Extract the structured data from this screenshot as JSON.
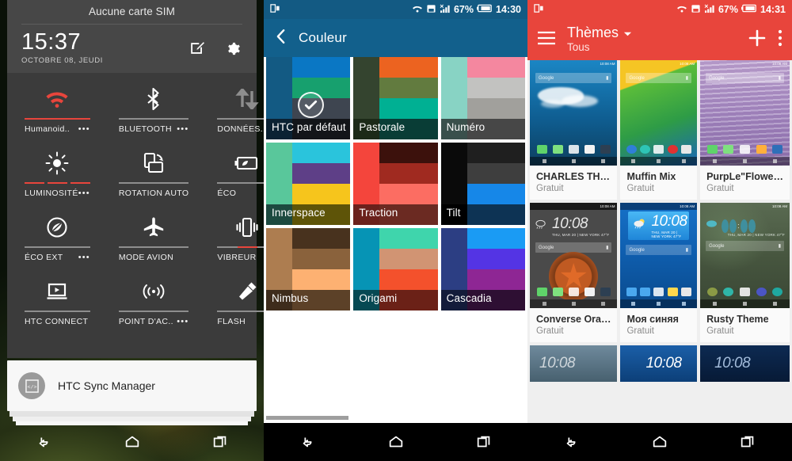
{
  "panel1": {
    "name": "quick-settings-shade",
    "sim_status": "Aucune carte SIM",
    "time": "15:37",
    "date": "OCTOBRE 08, JEUDI",
    "actions": [
      {
        "name": "edit-icon",
        "label": "Modifier"
      },
      {
        "name": "settings-gear-icon",
        "label": "Paramètres"
      }
    ],
    "tiles": [
      {
        "icon": "wifi-icon",
        "label": "Humanoid..",
        "dots": "•••",
        "state": "on",
        "accent": "#e8453c"
      },
      {
        "icon": "bluetooth-icon",
        "label": "BLUETOOTH",
        "dots": "•••",
        "state": "off",
        "accent": "#8e8e8e"
      },
      {
        "icon": "data-sync-icon",
        "label": "DONNÉES..",
        "dots": "•••",
        "state": "off",
        "accent": "#8e8e8e"
      },
      {
        "icon": "brightness-icon",
        "label": "LUMINOSITÉ",
        "dots": "•••",
        "state": "segmented",
        "accent": "#e8453c"
      },
      {
        "icon": "auto-rotate-icon",
        "label": "ROTATION AUTO",
        "dots": "",
        "state": "off",
        "accent": "#8e8e8e"
      },
      {
        "icon": "eco-battery-icon",
        "label": "ÉCO",
        "dots": "•••",
        "state": "off",
        "accent": "#8e8e8e"
      },
      {
        "icon": "eco-extreme-icon",
        "label": "ÉCO EXT",
        "dots": "•••",
        "state": "off",
        "accent": "#8e8e8e"
      },
      {
        "icon": "airplane-icon",
        "label": "MODE AVION",
        "dots": "",
        "state": "off",
        "accent": "#8e8e8e"
      },
      {
        "icon": "vibrate-icon",
        "label": "VIBREUR",
        "dots": "",
        "state": "middle",
        "accent": "#e8453c"
      },
      {
        "icon": "htc-connect-icon",
        "label": "HTC CONNECT",
        "dots": "",
        "state": "off",
        "accent": "#8e8e8e"
      },
      {
        "icon": "hotspot-icon",
        "label": "POINT D'AC..",
        "dots": "•••",
        "state": "off",
        "accent": "#8e8e8e"
      },
      {
        "icon": "flashlight-icon",
        "label": "FLASH",
        "dots": "",
        "state": "off",
        "accent": "#8e8e8e"
      }
    ],
    "notification": {
      "title": "HTC Sync Manager",
      "avatar_icon": "code-brackets-icon"
    },
    "navbar": [
      {
        "name": "back-nav-button",
        "icon": "back-arrow-icon"
      },
      {
        "name": "home-nav-button",
        "icon": "home-icon"
      },
      {
        "name": "recents-nav-button",
        "icon": "recents-icon"
      }
    ]
  },
  "panel2": {
    "name": "color-theme-picker",
    "status_bar": {
      "left_icon": "dual-window-icon",
      "icons": [
        "wifi-icon",
        "sd-card-icon",
        "signal-icon"
      ],
      "battery_percent": "67%",
      "battery_icon": "battery-icon",
      "time": "14:30",
      "bg": "#135a83"
    },
    "app_bar": {
      "back_icon": "back-chevron-icon",
      "title": "Couleur",
      "bg": "#12608c"
    },
    "themes": [
      {
        "name": "HTC par défaut",
        "selected": true,
        "sidebar": [
          "#135a83",
          "#135a83",
          "#135a83",
          "#0b2233"
        ],
        "main": [
          "#0a77c4",
          "#17a06e",
          "#3e4550",
          "#131519"
        ]
      },
      {
        "name": "Pastorale",
        "selected": false,
        "sidebar": [
          "#34442f",
          "#34442f",
          "#34442f",
          "#1c2a18"
        ],
        "main": [
          "#ec6320",
          "#627b3f",
          "#00b093",
          "#093d36"
        ]
      },
      {
        "name": "Numéro",
        "selected": false,
        "sidebar": [
          "#88d3c4",
          "#88d3c4",
          "#88d3c4",
          "#3a504c"
        ],
        "main": [
          "#f4879f",
          "#c2c2c0",
          "#a1a09c",
          "#474747"
        ]
      },
      {
        "name": "Innerspace",
        "selected": false,
        "sidebar": [
          "#59c79b",
          "#59c79b",
          "#59c79b",
          "#1d4a40"
        ],
        "main": [
          "#2ac4dc",
          "#5e3f87",
          "#f6c51c",
          "#5e5408"
        ]
      },
      {
        "name": "Traction",
        "selected": false,
        "sidebar": [
          "#f4453c",
          "#f4453c",
          "#f4453c",
          "#6b211c"
        ],
        "main": [
          "#3c110c",
          "#a02a20",
          "#fc6d62",
          "#6b2a22"
        ]
      },
      {
        "name": "Tilt",
        "selected": false,
        "sidebar": [
          "#0a0a0a",
          "#0a0a0a",
          "#0a0a0a",
          "#000000"
        ],
        "main": [
          "#1f1f1f",
          "#3e3e3e",
          "#1687e8",
          "#0d3354"
        ]
      },
      {
        "name": "Nimbus",
        "selected": false,
        "sidebar": [
          "#ad7d50",
          "#ad7d50",
          "#ad7d50",
          "#3e2c1c"
        ],
        "main": [
          "#48321e",
          "#8a623c",
          "#fdb172",
          "#5c4128"
        ]
      },
      {
        "name": "Origami",
        "selected": false,
        "sidebar": [
          "#0694b5",
          "#0694b5",
          "#0694b5",
          "#064953"
        ],
        "main": [
          "#3fd5ac",
          "#d19473",
          "#f4512c",
          "#6b2117"
        ]
      },
      {
        "name": "Cascadia",
        "selected": false,
        "sidebar": [
          "#2c3e83",
          "#2c3e83",
          "#2c3e83",
          "#131b3a"
        ],
        "main": [
          "#1a9bf4",
          "#5434e4",
          "#8e2694",
          "#2e0f33"
        ]
      }
    ],
    "check_icon": "checkmark-circle-icon",
    "navbar": [
      {
        "name": "back-nav-button",
        "icon": "back-arrow-icon"
      },
      {
        "name": "home-nav-button",
        "icon": "home-icon"
      },
      {
        "name": "recents-nav-button",
        "icon": "recents-icon"
      }
    ]
  },
  "panel3": {
    "name": "themes-store",
    "status_bar": {
      "left_icon": "dual-window-icon",
      "icons": [
        "wifi-icon",
        "sd-card-icon",
        "signal-icon"
      ],
      "battery_percent": "67%",
      "battery_icon": "battery-icon",
      "time": "14:31",
      "bg": "#e8453c"
    },
    "app_bar": {
      "menu_icon": "hamburger-menu-icon",
      "title": "Thèmes",
      "dropdown_icon": "chevron-down-icon",
      "subtitle": "Tous",
      "add_icon": "plus-icon",
      "overflow_icon": "overflow-menu-icon",
      "bg": "#e8453c"
    },
    "price_label": "Gratuit",
    "widget_time": "10:08",
    "widget_ampm": "AM",
    "widget_sub": "THU, MAR 20 | NEW YORK 47°F",
    "search_hint": "Google",
    "status_mini": "10:08 AM",
    "themes": [
      {
        "name": "CHARLES TH…",
        "price": "Gratuit",
        "bg": "#1d7fb8",
        "style": "clouds"
      },
      {
        "name": "Muffin Mix",
        "price": "Gratuit",
        "bg": "#3fbf3f",
        "style": "material"
      },
      {
        "name": "PurpLe\"Flowe…",
        "price": "Gratuit",
        "bg": "#b49ccc",
        "style": "wisteria"
      },
      {
        "name": "Converse Ora…",
        "price": "Gratuit",
        "bg": "#3b3b3b",
        "style": "converse"
      },
      {
        "name": "Моя синяя",
        "price": "Gratuit",
        "bg": "#1166bb",
        "style": "blue"
      },
      {
        "name": "Rusty Theme",
        "price": "Gratuit",
        "bg": "#4d5a48",
        "style": "rust"
      }
    ],
    "navbar": [
      {
        "name": "back-nav-button",
        "icon": "back-arrow-icon"
      },
      {
        "name": "home-nav-button",
        "icon": "home-icon"
      },
      {
        "name": "recents-nav-button",
        "icon": "recents-icon"
      }
    ]
  }
}
